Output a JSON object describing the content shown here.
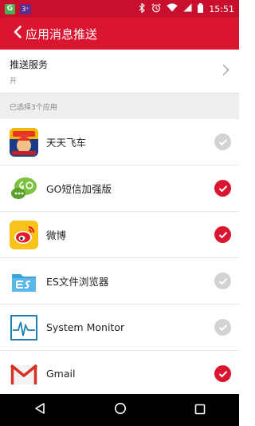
{
  "status_bar": {
    "time": "15:51",
    "notif_g_label": "G",
    "notif_3_label": "3⁺",
    "icons": [
      "bluetooth-icon",
      "alarm-icon",
      "wifi-icon",
      "signal-icon",
      "battery-icon"
    ]
  },
  "app_bar": {
    "title": "应用消息推送",
    "back_icon": "back-chevron-icon"
  },
  "push_service": {
    "label": "推送服务",
    "value": "开"
  },
  "section": {
    "header": "已选择3个应用"
  },
  "apps": [
    {
      "name": "天天飞车",
      "checked": false,
      "icon": "tiantian-feiche-icon"
    },
    {
      "name": "GO短信加强版",
      "checked": true,
      "icon": "go-sms-icon"
    },
    {
      "name": "微博",
      "checked": true,
      "icon": "weibo-icon"
    },
    {
      "name": "ES文件浏览器",
      "checked": false,
      "icon": "es-file-explorer-icon"
    },
    {
      "name": "System Monitor",
      "checked": false,
      "icon": "system-monitor-icon"
    },
    {
      "name": "Gmail",
      "checked": true,
      "icon": "gmail-icon"
    }
  ],
  "colors": {
    "accent": "#d9152f",
    "status_bar": "#c8102e",
    "unchecked": "#d3d3d3",
    "section_bg": "#eeeeee"
  },
  "nav_bar": {
    "icons": [
      "back-triangle-icon",
      "home-circle-icon",
      "recents-square-icon"
    ]
  }
}
